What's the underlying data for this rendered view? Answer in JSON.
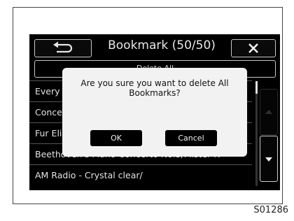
{
  "header": {
    "title": "Bookmark (50/50)"
  },
  "delete_all_label": "Delete All",
  "list_items": [
    "Every",
    "Concer",
    "Fur Eli",
    "Beethoven's Piano Concerto No.5/Mister P.",
    "AM Radio - Crystal clear/"
  ],
  "dialog": {
    "message": "Are you sure you want to delete All Bookmarks?",
    "ok_label": "OK",
    "cancel_label": "Cancel"
  },
  "caption": "S01286",
  "icons": {
    "back": "back-arrow-icon",
    "close": "close-x-icon",
    "scroll_up": "triangle-up-icon",
    "scroll_down": "triangle-down-icon"
  },
  "colors": {
    "screen_bg": "#000000",
    "dialog_bg": "#f2f2f2",
    "text_light": "#e2e2e2"
  }
}
